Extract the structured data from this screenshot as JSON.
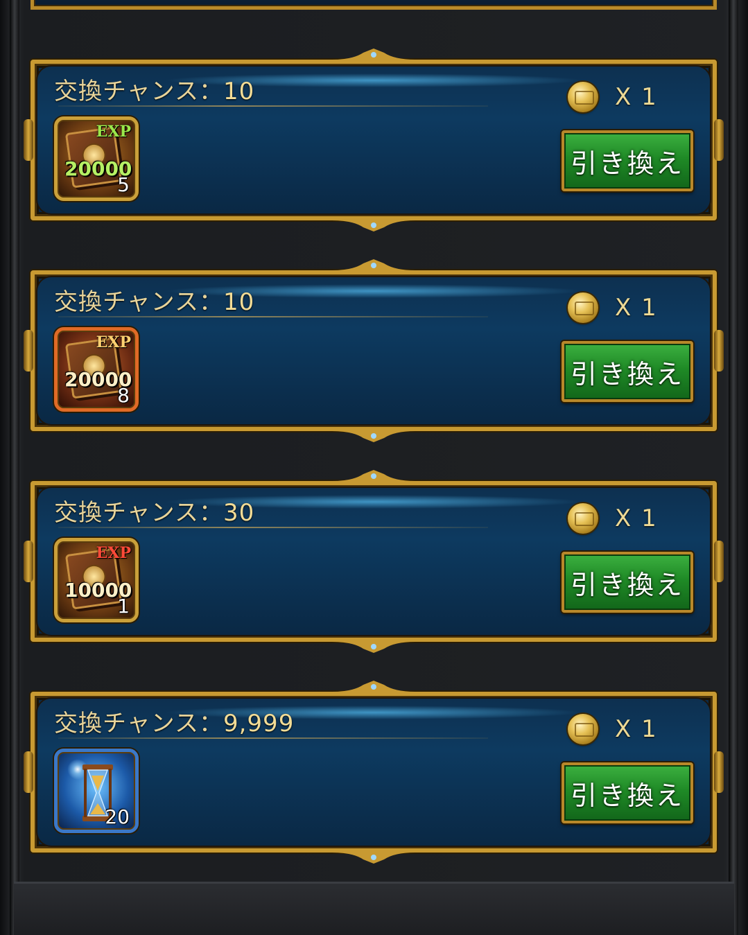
{
  "exchange": {
    "chance_prefix": "交換チャンス：",
    "redeem_label": "引き換え",
    "cost_prefix": "X",
    "items": [
      {
        "chance": "10",
        "cost": "1",
        "exp_tag": "EXP",
        "exp_amount": "20000",
        "qty": "5",
        "icon": "exp-book-green-icon"
      },
      {
        "chance": "10",
        "cost": "1",
        "exp_tag": "EXP",
        "exp_amount": "20000",
        "qty": "8",
        "icon": "exp-book-orange-icon"
      },
      {
        "chance": "30",
        "cost": "1",
        "exp_tag": "EXP",
        "exp_amount": "10000",
        "qty": "1",
        "icon": "exp-book-red-icon"
      },
      {
        "chance": "9,999",
        "cost": "1",
        "exp_tag": "",
        "exp_amount": "",
        "qty": "20",
        "icon": "hourglass-icon"
      }
    ]
  },
  "colors": {
    "frame_gold": "#c89a32",
    "panel_blue": "#0d3557",
    "button_green": "#1f8a26",
    "label_gold": "#e8d49a"
  }
}
